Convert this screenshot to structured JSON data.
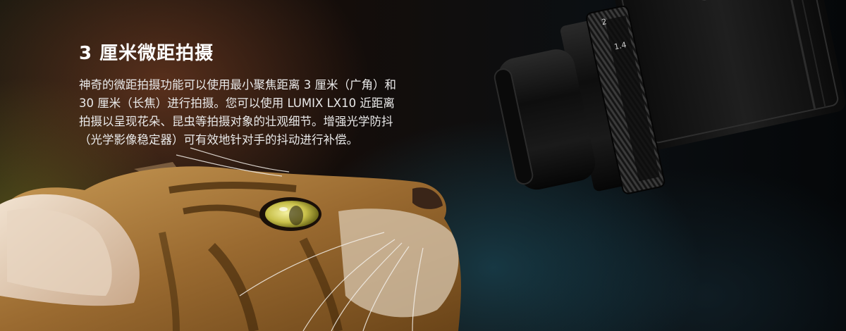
{
  "feature": {
    "title": "3 厘米微距拍摄",
    "body_lines": [
      "神奇的微距拍摄功能可以使用最小聚焦距离 3 厘米（广角）和",
      "30 厘米（长焦）进行拍摄。您可以使用 LUMIX LX10 近距离",
      "拍摄以呈现花朵、昆虫等拍摄对象的壮观细节。增强光学防抖",
      "（光学影像稳定器）可有效地针对手的抖动进行补偿。"
    ]
  },
  "lens_ring": {
    "mark_1": "2",
    "mark_2": "1.4"
  },
  "colors": {
    "text": "#ffffff",
    "body_text": "#eaeaea",
    "background_dark": "#05070a"
  }
}
